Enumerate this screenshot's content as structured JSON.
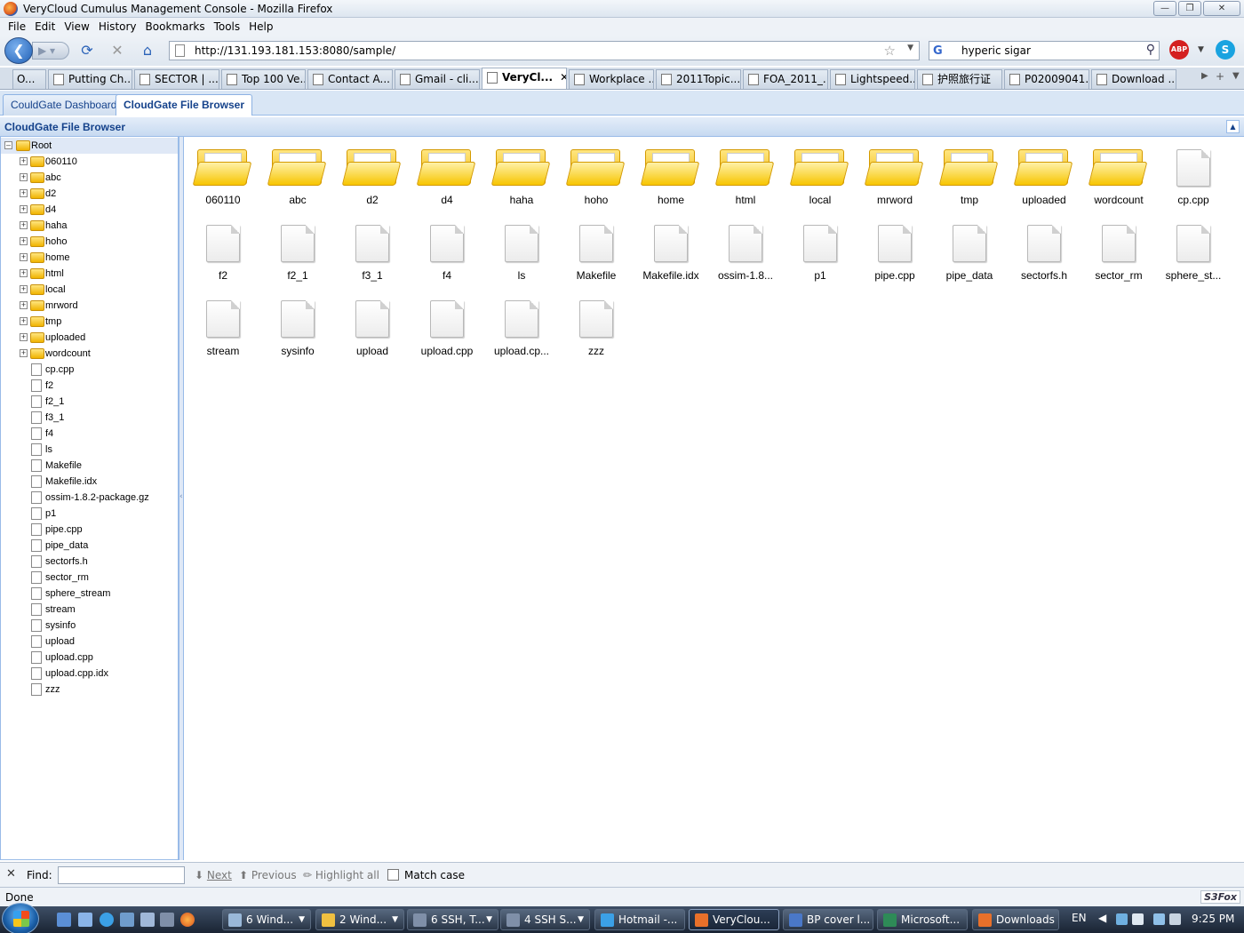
{
  "window": {
    "title": "VeryCloud Cumulus Management Console - Mozilla Firefox"
  },
  "menu": [
    "File",
    "Edit",
    "View",
    "History",
    "Bookmarks",
    "Tools",
    "Help"
  ],
  "nav": {
    "url": "http://131.193.181.153:8080/sample/",
    "search_value": "hyperic sigar",
    "abp_label": "ABP"
  },
  "browser_tabs": [
    {
      "label": "O..."
    },
    {
      "label": "Putting Ch..."
    },
    {
      "label": "SECTOR | ..."
    },
    {
      "label": "Top 100 Ve..."
    },
    {
      "label": "Contact A..."
    },
    {
      "label": "Gmail - cli..."
    },
    {
      "label": "VeryCl...",
      "active": true
    },
    {
      "label": "Workplace ..."
    },
    {
      "label": "2011Topic..."
    },
    {
      "label": "FOA_2011_..."
    },
    {
      "label": "Lightspeed..."
    },
    {
      "label": "护照旅行证"
    },
    {
      "label": "P02009041..."
    },
    {
      "label": "Download ..."
    }
  ],
  "app_tabs": {
    "dashboard": "CouldGate Dashboard",
    "file_browser": "CloudGate File Browser"
  },
  "panel": {
    "title": "CloudGate File Browser"
  },
  "tree": {
    "root": "Root",
    "folders": [
      "060110",
      "abc",
      "d2",
      "d4",
      "haha",
      "hoho",
      "home",
      "html",
      "local",
      "mrword",
      "tmp",
      "uploaded",
      "wordcount"
    ],
    "files": [
      "cp.cpp",
      "f2",
      "f2_1",
      "f3_1",
      "f4",
      "ls",
      "Makefile",
      "Makefile.idx",
      "ossim-1.8.2-package.gz",
      "p1",
      "pipe.cpp",
      "pipe_data",
      "sectorfs.h",
      "sector_rm",
      "sphere_stream",
      "stream",
      "sysinfo",
      "upload",
      "upload.cpp",
      "upload.cpp.idx",
      "zzz"
    ]
  },
  "icon_view": [
    {
      "label": "060110",
      "kind": "folder"
    },
    {
      "label": "abc",
      "kind": "folder"
    },
    {
      "label": "d2",
      "kind": "folder"
    },
    {
      "label": "d4",
      "kind": "folder"
    },
    {
      "label": "haha",
      "kind": "folder"
    },
    {
      "label": "hoho",
      "kind": "folder"
    },
    {
      "label": "home",
      "kind": "folder"
    },
    {
      "label": "html",
      "kind": "folder"
    },
    {
      "label": "local",
      "kind": "folder"
    },
    {
      "label": "mrword",
      "kind": "folder"
    },
    {
      "label": "tmp",
      "kind": "folder"
    },
    {
      "label": "uploaded",
      "kind": "folder"
    },
    {
      "label": "wordcount",
      "kind": "folder"
    },
    {
      "label": "cp.cpp",
      "kind": "file"
    },
    {
      "label": "f2",
      "kind": "file"
    },
    {
      "label": "f2_1",
      "kind": "file"
    },
    {
      "label": "f3_1",
      "kind": "file"
    },
    {
      "label": "f4",
      "kind": "file"
    },
    {
      "label": "ls",
      "kind": "file"
    },
    {
      "label": "Makefile",
      "kind": "file"
    },
    {
      "label": "Makefile.idx",
      "kind": "file"
    },
    {
      "label": "ossim-1.8...",
      "kind": "file"
    },
    {
      "label": "p1",
      "kind": "file"
    },
    {
      "label": "pipe.cpp",
      "kind": "file"
    },
    {
      "label": "pipe_data",
      "kind": "file"
    },
    {
      "label": "sectorfs.h",
      "kind": "file"
    },
    {
      "label": "sector_rm",
      "kind": "file"
    },
    {
      "label": "sphere_st...",
      "kind": "file"
    },
    {
      "label": "stream",
      "kind": "file"
    },
    {
      "label": "sysinfo",
      "kind": "file"
    },
    {
      "label": "upload",
      "kind": "file"
    },
    {
      "label": "upload.cpp",
      "kind": "file"
    },
    {
      "label": "upload.cp...",
      "kind": "file"
    },
    {
      "label": "zzz",
      "kind": "file"
    }
  ],
  "findbar": {
    "find_label": "Find:",
    "next": "Next",
    "previous": "Previous",
    "highlight": "Highlight all",
    "match_case": "Match case"
  },
  "status": {
    "text": "Done",
    "s3fox": "S3Fox"
  },
  "taskbar": {
    "buttons": [
      {
        "label": "6 Wind...",
        "arrow": true
      },
      {
        "label": "2 Wind...",
        "arrow": true
      },
      {
        "label": "6 SSH, T...",
        "arrow": true
      },
      {
        "label": "4 SSH S...",
        "arrow": true
      },
      {
        "label": "Hotmail -...",
        "arrow": false
      },
      {
        "label": "VeryClou...",
        "arrow": false,
        "active": true
      },
      {
        "label": "BP cover l...",
        "arrow": false
      },
      {
        "label": "Microsoft...",
        "arrow": false
      },
      {
        "label": "Downloads",
        "arrow": false
      }
    ],
    "language": "EN",
    "clock": "9:25 PM"
  }
}
